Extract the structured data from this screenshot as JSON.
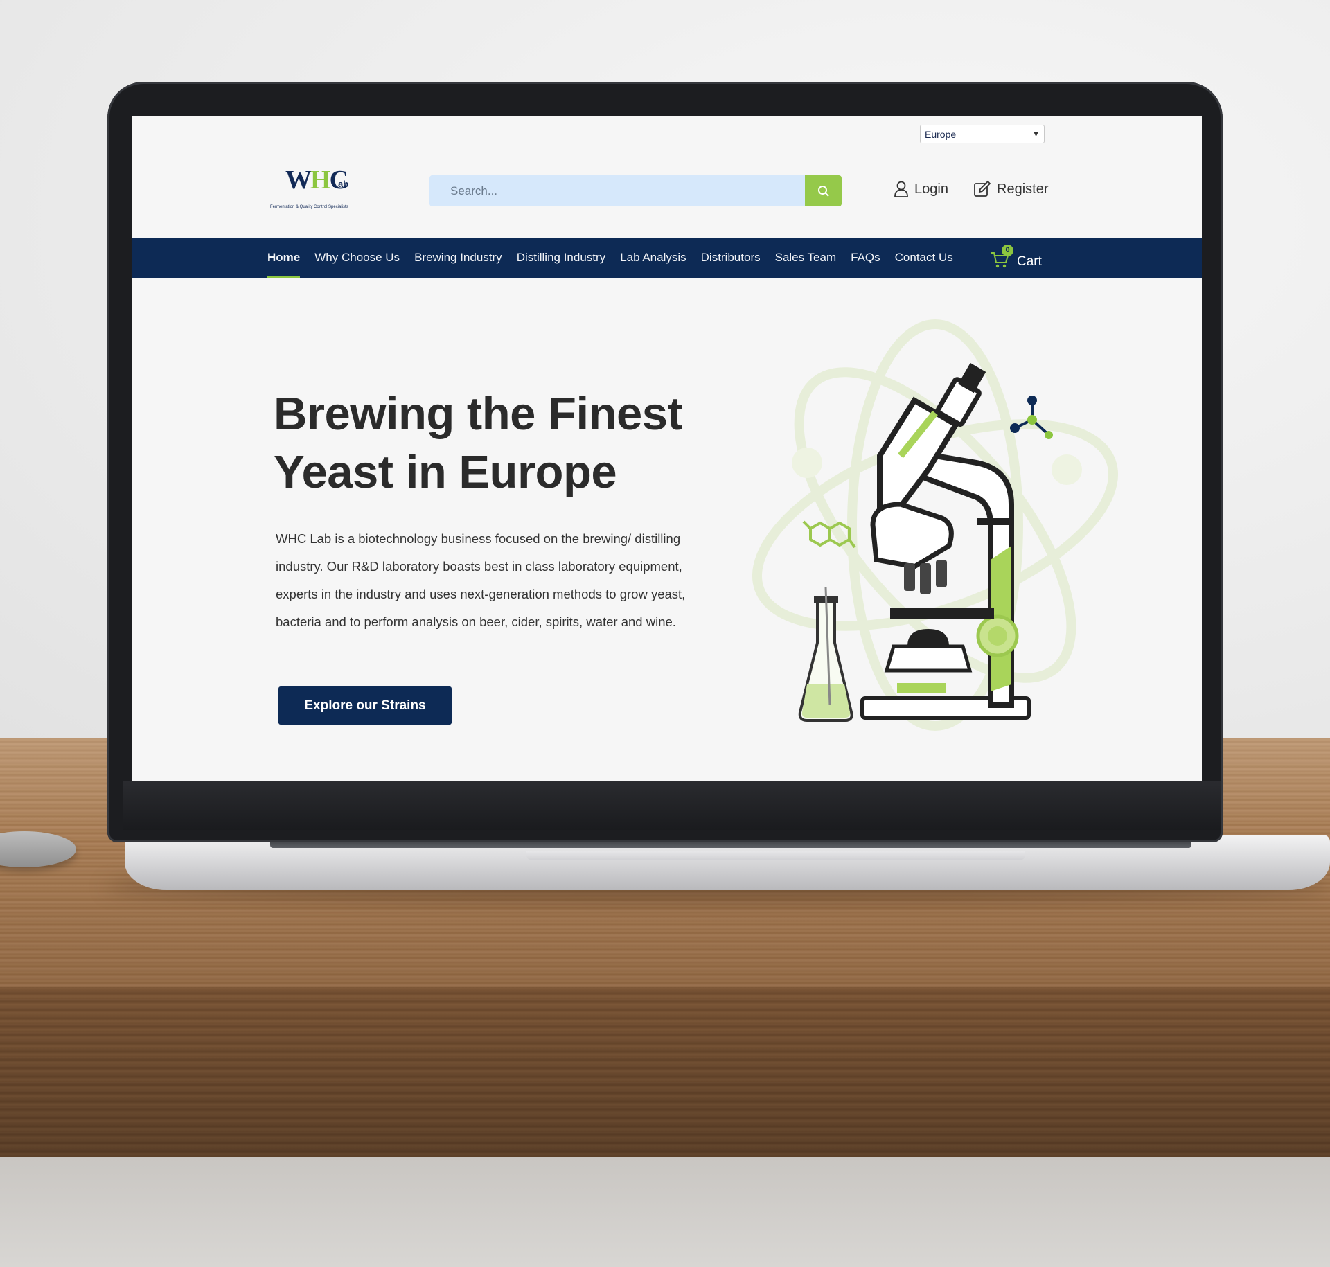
{
  "site": {
    "logo": {
      "mark_text": "WHC",
      "sub_text": "Lab",
      "tagline": "Fermentation & Quality Control Specialists"
    },
    "region_select": {
      "selected": "Europe"
    },
    "search": {
      "placeholder": "Search..."
    },
    "account": {
      "login_label": "Login",
      "register_label": "Register"
    },
    "nav": {
      "items": [
        {
          "label": "Home"
        },
        {
          "label": "Why Choose Us"
        },
        {
          "label": "Brewing Industry"
        },
        {
          "label": "Distilling Industry"
        },
        {
          "label": "Lab Analysis"
        },
        {
          "label": "Distributors"
        },
        {
          "label": "Sales Team"
        },
        {
          "label": "FAQs"
        },
        {
          "label": "Contact Us"
        }
      ],
      "active": "Home",
      "cart": {
        "label": "Cart",
        "count": "0"
      }
    },
    "hero": {
      "title": "Brewing the Finest Yeast in Europe",
      "body": "WHC Lab is a biotechnology business focused on the brewing/ distilling industry. Our R&D laboratory boasts best in class laboratory equipment, experts in the industry and uses next-generation methods to grow yeast, bacteria and to perform analysis on beer, cider, spirits, water and wine.",
      "button_label": "Explore our Strains"
    }
  },
  "colors": {
    "navy": "#0d2a55",
    "accent_green": "#8cc63f",
    "search_bg": "#d6e8fb",
    "page_bg": "#f6f6f6",
    "text": "#2b2b2b"
  },
  "icons": {
    "search_button": "search-icon",
    "login": "user-icon",
    "register": "edit-icon",
    "cart": "cart-icon",
    "region": "chevron-down-icon"
  }
}
